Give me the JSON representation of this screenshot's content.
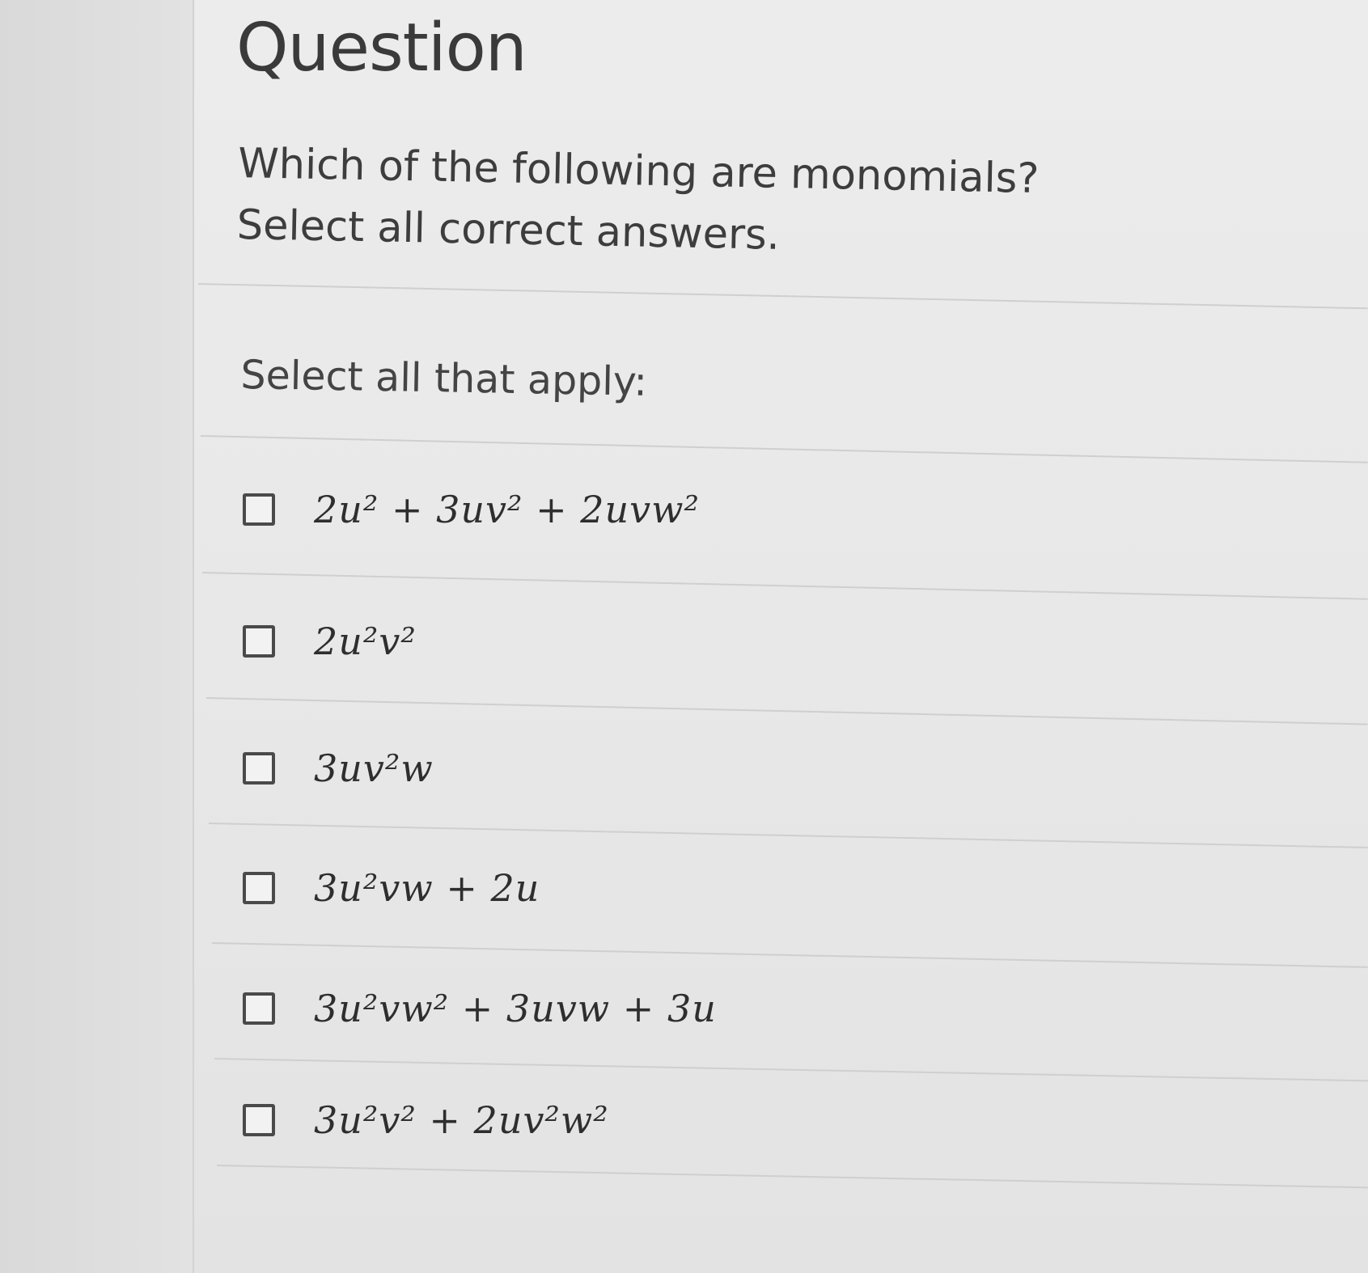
{
  "question": {
    "title": "Question",
    "prompt_line1": "Which of the following are monomials?",
    "prompt_line2": "Select all correct answers."
  },
  "instruction": "Select all that apply:",
  "options": [
    {
      "expression": "2u² + 3uv² + 2uvw²",
      "checked": false
    },
    {
      "expression": "2u²v²",
      "checked": false
    },
    {
      "expression": "3uv²w",
      "checked": false
    },
    {
      "expression": "3u²vw + 2u",
      "checked": false
    },
    {
      "expression": "3u²vw² + 3uvw + 3u",
      "checked": false
    },
    {
      "expression": "3u²v² + 2uv²w²",
      "checked": false
    }
  ]
}
